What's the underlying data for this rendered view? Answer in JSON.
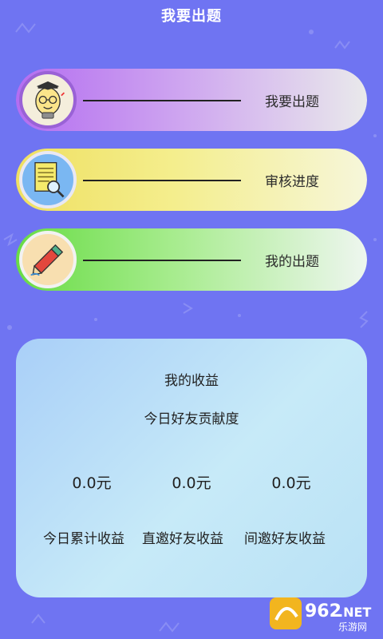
{
  "header": {
    "title": "我要出题"
  },
  "menu": [
    {
      "label": "我要出题",
      "icon": "lightbulb-professor-icon"
    },
    {
      "label": "审核进度",
      "icon": "document-magnifier-icon"
    },
    {
      "label": "我的出题",
      "icon": "pencil-icon"
    }
  ],
  "earnings": {
    "title": "我的收益",
    "subtitle": "今日好友贡献度",
    "values": [
      "0.0元",
      "0.0元",
      "0.0元"
    ],
    "labels": [
      "今日累计收益",
      "直邀好友收益",
      "间邀好友收益"
    ]
  },
  "watermark": {
    "brand": "962",
    "tld": ".NET",
    "site": "乐游网"
  },
  "colors": {
    "background": "#6f74f2",
    "row1": "#b46df1",
    "row2": "#efe062",
    "row3": "#68dc45",
    "card": "#c7eaf8"
  }
}
